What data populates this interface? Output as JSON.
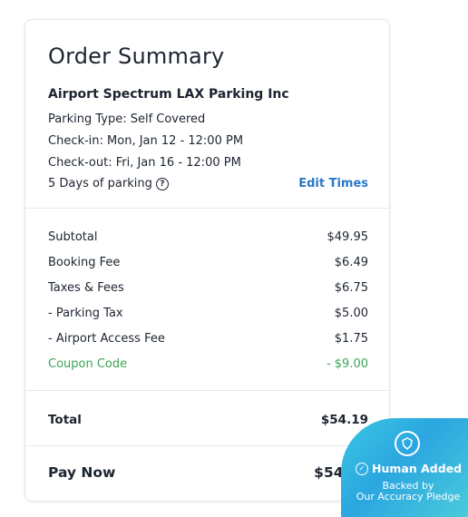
{
  "order": {
    "title": "Order Summary",
    "facility": "Airport Spectrum LAX Parking Inc",
    "parking_type": "Parking Type: Self Covered",
    "check_in": "Check-in: Mon, Jan 12 - 12:00 PM",
    "check_out": "Check-out: Fri, Jan 16 - 12:00 PM",
    "days": "5 Days of parking",
    "edit_times": "Edit Times"
  },
  "charges": [
    {
      "label": "Subtotal",
      "value": "$49.95"
    },
    {
      "label": "Booking Fee",
      "value": "$6.49"
    },
    {
      "label": "Taxes & Fees",
      "value": "$6.75"
    },
    {
      "label": "- Parking Tax",
      "value": "$5.00"
    },
    {
      "label": "- Airport Access Fee",
      "value": "$1.75"
    },
    {
      "label": "Coupon Code",
      "value": "- $9.00"
    }
  ],
  "total": {
    "label": "Total",
    "value": "$54.19"
  },
  "pay_now": {
    "label": "Pay Now",
    "value": "$54.19"
  },
  "badge": {
    "title": "Human Added",
    "line2": "Backed by",
    "line3": "Our Accuracy Pledge",
    "icon": "shield-icon"
  },
  "colors": {
    "accent_link": "#2b78c5",
    "coupon_green": "#3aa655",
    "badge_blue": "#2ba6e0"
  }
}
